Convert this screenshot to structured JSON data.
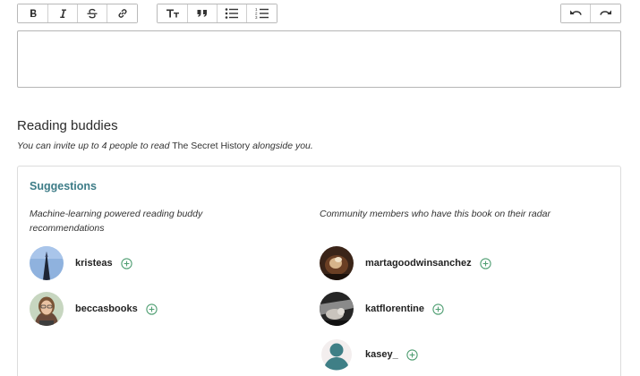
{
  "toolbar": {
    "format_buttons": [
      {
        "name": "bold-button",
        "icon": "bold-icon"
      },
      {
        "name": "italic-button",
        "icon": "italic-icon"
      },
      {
        "name": "strikethrough-button",
        "icon": "strikethrough-icon"
      },
      {
        "name": "link-button",
        "icon": "link-icon"
      }
    ],
    "block_buttons": [
      {
        "name": "heading-button",
        "icon": "heading-icon"
      },
      {
        "name": "quote-button",
        "icon": "quote-icon"
      },
      {
        "name": "bulleted-list-button",
        "icon": "bulleted-list-icon"
      },
      {
        "name": "numbered-list-button",
        "icon": "numbered-list-icon"
      }
    ],
    "history_buttons": [
      {
        "name": "undo-button",
        "icon": "undo-icon"
      },
      {
        "name": "redo-button",
        "icon": "redo-icon"
      }
    ]
  },
  "editor": {
    "value": ""
  },
  "reading_buddies": {
    "title": "Reading buddies",
    "subtitle_prefix": "You can invite up to 4 people to read",
    "book_title": "The Secret History",
    "subtitle_suffix": "alongside you."
  },
  "suggestions": {
    "title": "Suggestions",
    "left_column": {
      "description": "Machine-learning powered reading buddy recommendations",
      "users": [
        {
          "username": "kristeas"
        },
        {
          "username": "beccasbooks"
        }
      ]
    },
    "right_column": {
      "description": "Community members who have this book on their radar",
      "users": [
        {
          "username": "martagoodwinsanchez"
        },
        {
          "username": "katflorentine"
        },
        {
          "username": "kasey_"
        }
      ]
    }
  },
  "colors": {
    "accent": "#3d7c87",
    "add_icon": "#4f9e72",
    "border": "#b5b5b5"
  }
}
